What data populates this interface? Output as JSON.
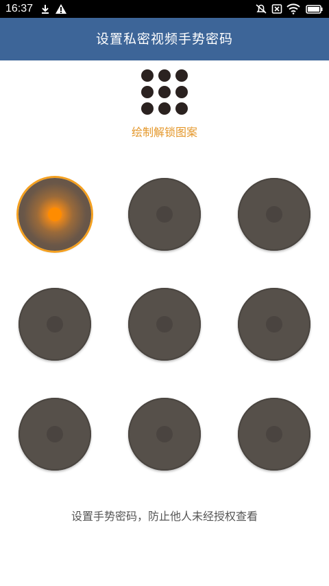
{
  "status_bar": {
    "time": "16:37",
    "icons": [
      "download-icon",
      "warning-icon",
      "mute-notifications-icon",
      "no-sim-icon",
      "wifi-icon",
      "battery-icon"
    ],
    "background": "#000000"
  },
  "title_bar": {
    "title": "设置私密视频手势密码",
    "background": "#3d6598"
  },
  "indicator": {
    "hint": "绘制解锁图案",
    "hint_color": "#e4972a"
  },
  "pattern": {
    "nodes": [
      {
        "id": 1,
        "active": true
      },
      {
        "id": 2,
        "active": false
      },
      {
        "id": 3,
        "active": false
      },
      {
        "id": 4,
        "active": false
      },
      {
        "id": 5,
        "active": false
      },
      {
        "id": 6,
        "active": false
      },
      {
        "id": 7,
        "active": false
      },
      {
        "id": 8,
        "active": false
      },
      {
        "id": 9,
        "active": false
      }
    ],
    "active_color": "#ff8c00",
    "node_color": "#56504a"
  },
  "footer": {
    "text": "设置手势密码，防止他人未经授权查看"
  }
}
